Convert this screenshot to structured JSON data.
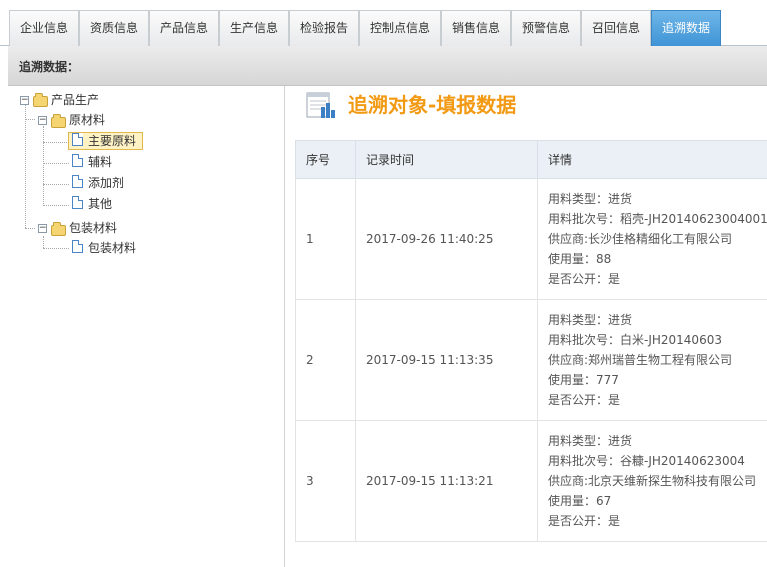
{
  "tabs": [
    {
      "label": "企业信息",
      "active": false
    },
    {
      "label": "资质信息",
      "active": false
    },
    {
      "label": "产品信息",
      "active": false
    },
    {
      "label": "生产信息",
      "active": false
    },
    {
      "label": "检验报告",
      "active": false
    },
    {
      "label": "控制点信息",
      "active": false
    },
    {
      "label": "销售信息",
      "active": false
    },
    {
      "label": "预警信息",
      "active": false
    },
    {
      "label": "召回信息",
      "active": false
    },
    {
      "label": "追溯数据",
      "active": true
    }
  ],
  "subheader": {
    "label": "追溯数据："
  },
  "tree": {
    "root": "产品生产",
    "raw_materials": "原材料",
    "raw_items": [
      "主要原料",
      "辅料",
      "添加剂",
      "其他"
    ],
    "packaging": "包装材料",
    "packaging_items": [
      "包装材料"
    ],
    "selected": "主要原料"
  },
  "main": {
    "title": "追溯对象-填报数据",
    "columns": [
      "序号",
      "记录时间",
      "详情"
    ],
    "rows": [
      {
        "no": "1",
        "time": "2017-09-26 11:40:25",
        "details": [
          "用料类型：进货",
          "用料批次号：稻壳-JH20140623004001",
          "供应商:长沙佳格精细化工有限公司",
          "使用量：88",
          "是否公开：是"
        ]
      },
      {
        "no": "2",
        "time": "2017-09-15 11:13:35",
        "details": [
          "用料类型：进货",
          "用料批次号：白米-JH20140603",
          "供应商:郑州瑞普生物工程有限公司",
          "使用量：777",
          "是否公开：是"
        ]
      },
      {
        "no": "3",
        "time": "2017-09-15 11:13:21",
        "details": [
          "用料类型：进货",
          "用料批次号：谷糠-JH20140623004",
          "供应商:北京天维新探生物科技有限公司",
          "使用量：67",
          "是否公开：是"
        ]
      }
    ]
  }
}
